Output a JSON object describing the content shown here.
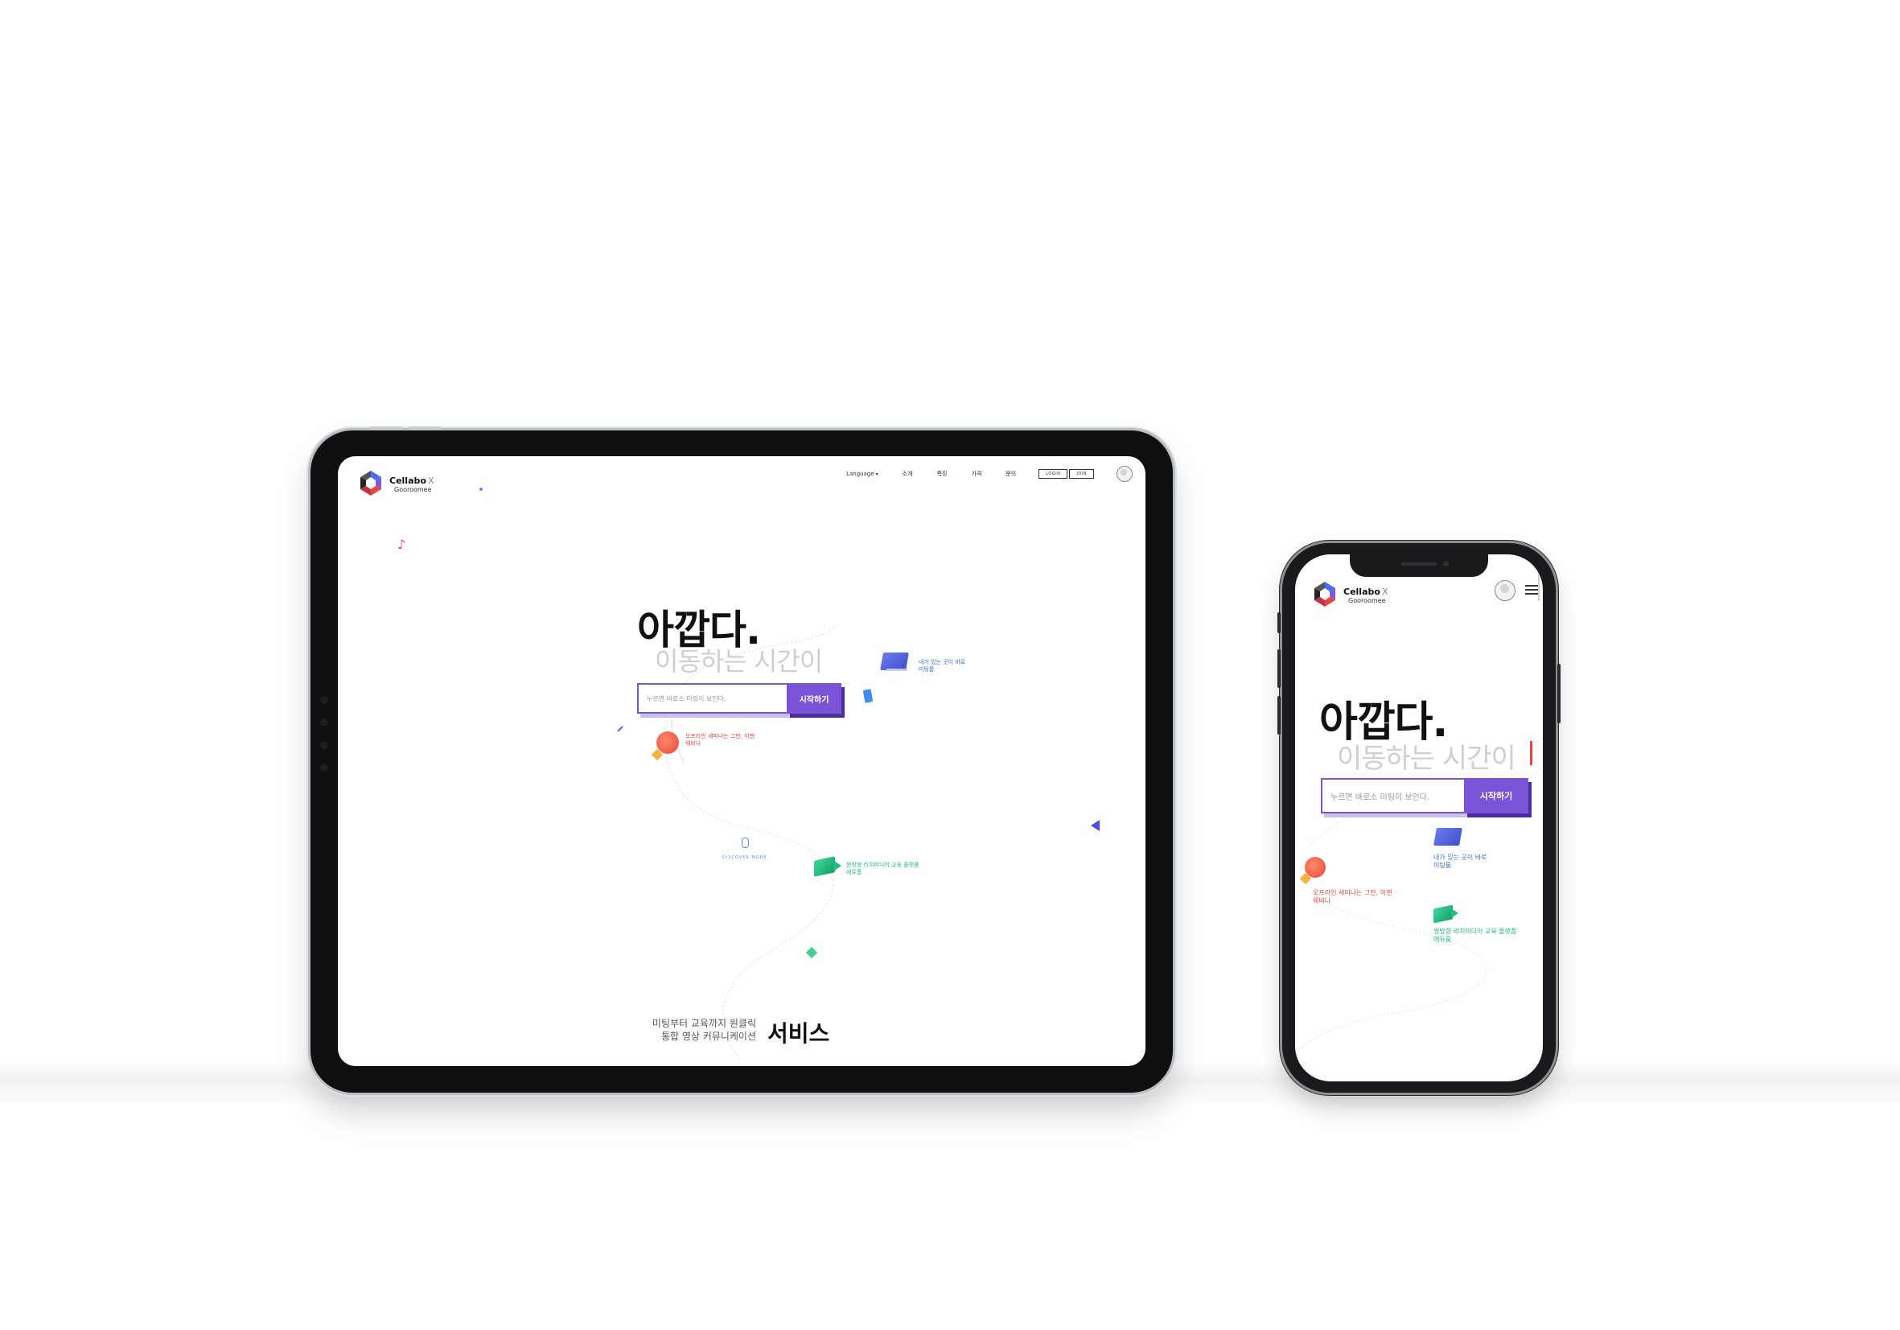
{
  "tablet": {
    "logo": {
      "brand": "Cellabo",
      "x_mark": "X",
      "sub": "Gooroomee"
    },
    "nav": {
      "language": "Language",
      "items": [
        "소개",
        "특징",
        "가격",
        "문의"
      ],
      "login": "LOGIN",
      "join": "JOIN"
    },
    "hero": {
      "headline": "아깝다.",
      "subline": "이동하는 시간이",
      "search_placeholder": "누르면 바로소 미팅이 보인다.",
      "start_button": "시작하기"
    },
    "features": {
      "room": [
        "내가 있는 곳이 바로",
        "미팅룸"
      ],
      "seminar": [
        "오프라인 세미나는 그만, 이젠",
        "웨비나"
      ],
      "mouse_hint": "DISCOVER MORE",
      "edu": [
        "쌍방향 리치미디어 교육 플랫폼",
        "에듀룸"
      ]
    },
    "service": {
      "line1": "미팅부터 교육까지 원클릭",
      "line2": "통합 영상 커뮤니케이션",
      "title": "서비스"
    }
  },
  "phone": {
    "logo": {
      "brand": "Cellabo",
      "x_mark": "X",
      "sub": "Gooroomee"
    },
    "hero": {
      "headline": "아깝다.",
      "subline": "이동하는 시간이",
      "search_placeholder": "누르면 바로소 미팅이 보인다.",
      "start_button": "시작하기"
    },
    "features": {
      "room": [
        "내가 있는 곳이 바로",
        "미팅룸"
      ],
      "seminar": [
        "오프라인 세미나는 그만, 이젠",
        "웨비나"
      ],
      "edu": [
        "쌍방향 리치미디어 교육 플랫폼",
        "에듀룸"
      ]
    }
  },
  "colors": {
    "accent_purple": "#7b53d6",
    "feature_blue": "#3f6fe0",
    "feature_red": "#e9473c",
    "feature_green": "#1fbf80",
    "device_frame": "#0f0f10"
  },
  "icons": [
    "logo-hexagon-icon",
    "chevron-down-icon",
    "user-avatar-icon",
    "laptop-icon",
    "phone-icon",
    "rocket-icon",
    "mouse-icon",
    "video-camera-icon",
    "music-note-icon",
    "triangle-icon",
    "hamburger-menu-icon"
  ]
}
